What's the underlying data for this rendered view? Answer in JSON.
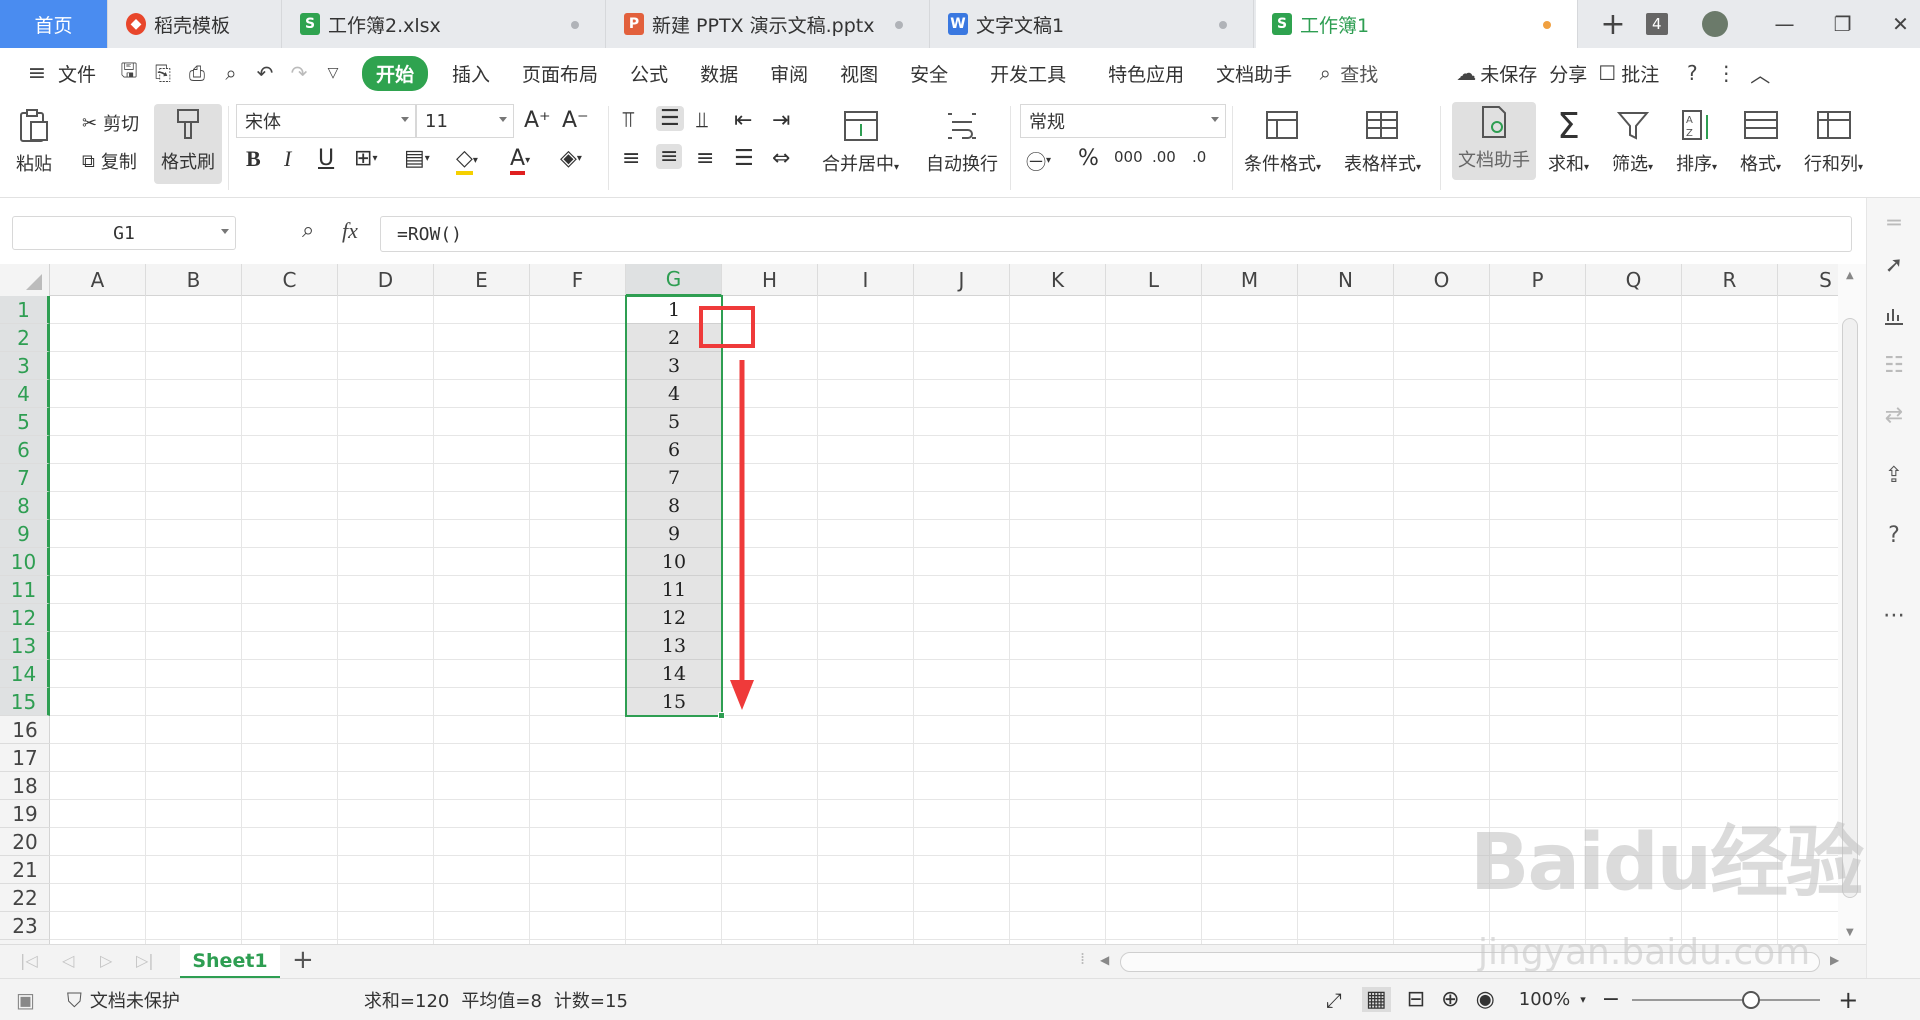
{
  "tabs": [
    {
      "label": "首页",
      "icon": "home"
    },
    {
      "label": "稻壳模板",
      "icon": "docer-icon",
      "icon_color": "#e8462b"
    },
    {
      "label": "工作簿2.xlsx",
      "icon": "sheet-icon",
      "icon_color": "#2fa34f"
    },
    {
      "label": "新建 PPTX 演示文稿.pptx",
      "icon": "ppt-icon",
      "icon_color": "#e2603c"
    },
    {
      "label": "文字文稿1",
      "icon": "word-icon",
      "icon_color": "#3a78e0"
    },
    {
      "label": "工作簿1",
      "icon": "sheet-icon",
      "icon_color": "#2fa34f"
    }
  ],
  "tab_count_badge": "4",
  "menu": {
    "file": "文件",
    "items": [
      "开始",
      "插入",
      "页面布局",
      "公式",
      "数据",
      "审阅",
      "视图",
      "安全",
      "开发工具",
      "特色应用",
      "文档助手"
    ],
    "search": "查找",
    "unsaved": "未保存",
    "share": "分享",
    "comment": "批注"
  },
  "ribbon": {
    "paste": "粘贴",
    "cut": "剪切",
    "copy": "复制",
    "format_painter": "格式刷",
    "font_name": "宋体",
    "font_size": "11",
    "bold": "B",
    "italic": "I",
    "underline": "U",
    "merge_center": "合并居中",
    "wrap_text": "自动换行",
    "number_format": "常规",
    "conditional_format": "条件格式",
    "table_style": "表格样式",
    "doc_assistant": "文档助手",
    "sum": "求和",
    "filter": "筛选",
    "sort": "排序",
    "format": "格式",
    "rows_cols": "行和列"
  },
  "formula_bar": {
    "name_box": "G1",
    "fx": "fx",
    "formula": "=ROW()"
  },
  "grid": {
    "columns": [
      "A",
      "B",
      "C",
      "D",
      "E",
      "F",
      "G",
      "H",
      "I",
      "J",
      "K",
      "L",
      "M",
      "N",
      "O",
      "P",
      "Q",
      "R",
      "S"
    ],
    "rows": [
      "1",
      "2",
      "3",
      "4",
      "5",
      "6",
      "7",
      "8",
      "9",
      "10",
      "11",
      "12",
      "13",
      "14",
      "15",
      "16",
      "17",
      "18",
      "19",
      "20",
      "21",
      "22",
      "23"
    ],
    "selected_column": "G",
    "g_values": [
      "1",
      "2",
      "3",
      "4",
      "5",
      "6",
      "7",
      "8",
      "9",
      "10",
      "11",
      "12",
      "13",
      "14",
      "15"
    ]
  },
  "sheet_tabs": [
    "Sheet1"
  ],
  "status": {
    "protect": "文档未保护",
    "sum": "求和=120",
    "avg": "平均值=8",
    "count": "计数=15",
    "zoom": "100%"
  },
  "watermark": {
    "logo": "Baidu经验",
    "url": "jingyan.baidu.com"
  },
  "colors": {
    "accent": "#2e9e52",
    "home_tab": "#4a8cf0",
    "annotation": "#ef3a3a"
  }
}
